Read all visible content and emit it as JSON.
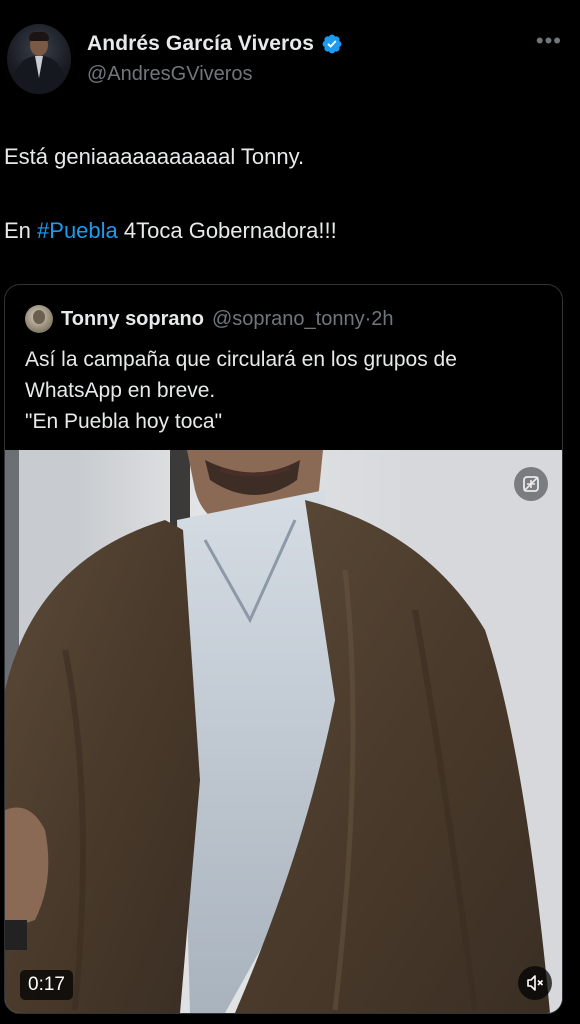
{
  "author": {
    "display_name": "Andrés García Viveros",
    "handle": "@AndresGViveros",
    "verified": true,
    "badge_color": "#1d9bf0",
    "more_label": "•••"
  },
  "tweet": {
    "line1": "Está geniaaaaaaaaaaal Tonny.",
    "line2_prefix": "En ",
    "line2_hashtag": "#Puebla",
    "line2_suffix": " 4Toca Gobernadora!!!"
  },
  "quoted": {
    "display_name": "Tonny soprano",
    "handle": "@soprano_tonny",
    "separator": "·",
    "time": "2h",
    "text_lines": [
      "Así la campaña que circulará en los grupos de",
      "WhatsApp en breve.",
      "\"En Puebla hoy toca\""
    ]
  },
  "video": {
    "duration": "0:17",
    "icons": [
      "gif-sticker-icon",
      "muted-speaker-icon"
    ]
  },
  "colors": {
    "background": "#000000",
    "text": "#e7e9ea",
    "muted": "#71767b",
    "link": "#1d9bf0",
    "border": "#2f3336"
  }
}
